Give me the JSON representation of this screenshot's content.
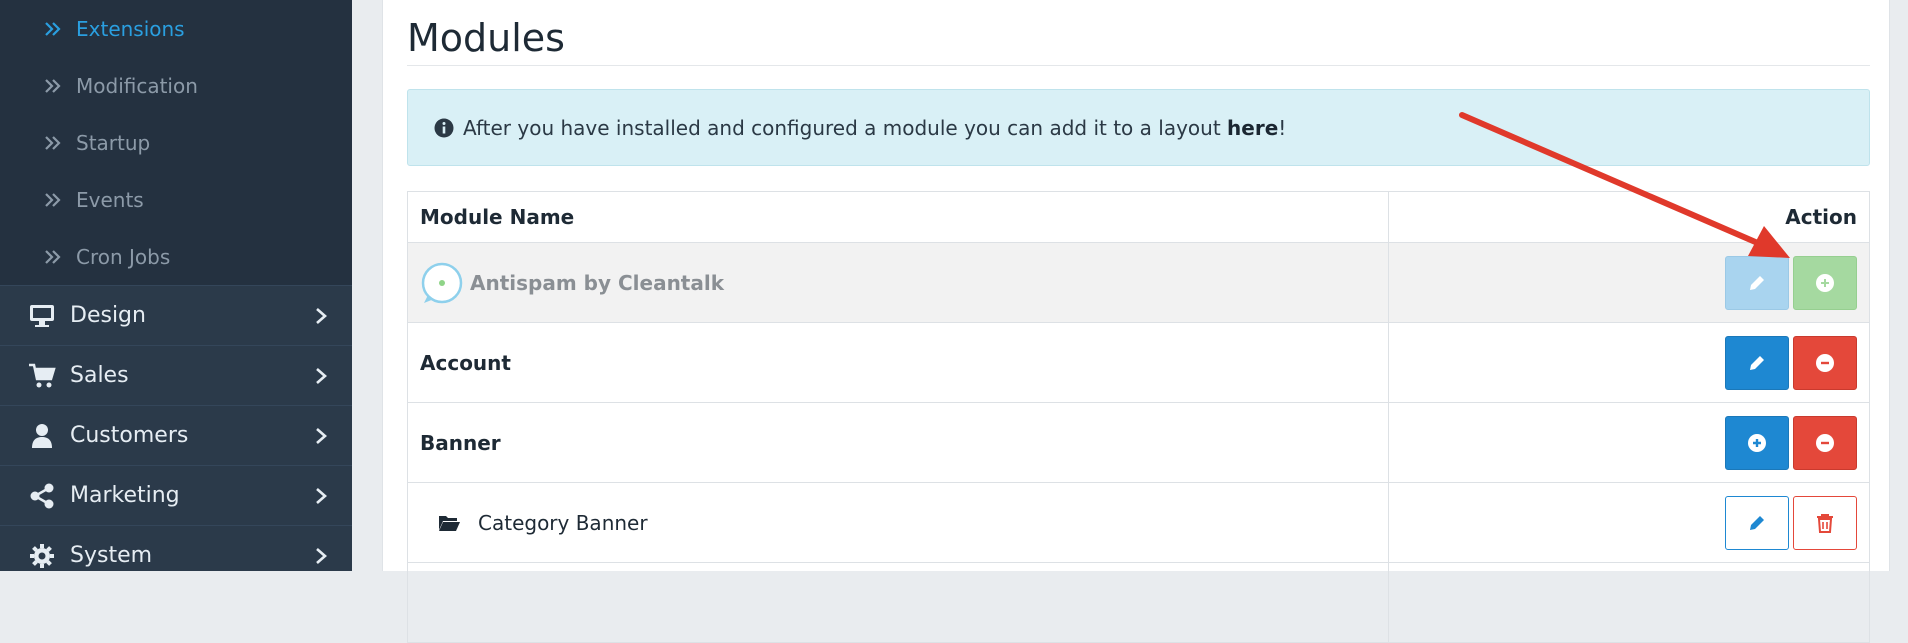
{
  "sidebar": {
    "sub_items": [
      {
        "label": "Extensions",
        "active": true
      },
      {
        "label": "Modification",
        "active": false
      },
      {
        "label": "Startup",
        "active": false
      },
      {
        "label": "Events",
        "active": false
      },
      {
        "label": "Cron Jobs",
        "active": false
      }
    ],
    "items": [
      {
        "label": "Design",
        "icon": "monitor-icon"
      },
      {
        "label": "Sales",
        "icon": "cart-icon"
      },
      {
        "label": "Customers",
        "icon": "user-icon"
      },
      {
        "label": "Marketing",
        "icon": "share-icon"
      },
      {
        "label": "System",
        "icon": "cog-icon"
      }
    ]
  },
  "page": {
    "title": "Modules",
    "alert_text": "After you have installed and configured a module you can add it to a layout",
    "alert_link": "here",
    "alert_suffix": "!"
  },
  "table": {
    "headers": {
      "name": "Module Name",
      "action": "Action"
    },
    "rows": [
      {
        "name": "Antispam by Cleantalk"
      },
      {
        "name": "Account"
      },
      {
        "name": "Banner"
      },
      {
        "name": "Category Banner"
      }
    ]
  },
  "colors": {
    "sidebar_bg": "#2b3a4a",
    "active_link": "#2a9fe0",
    "primary": "#1e88d2",
    "danger": "#e4483a",
    "success_light": "#a5d9a0",
    "alert_bg": "#d9f0f6",
    "annotation_arrow": "#e0392b"
  }
}
